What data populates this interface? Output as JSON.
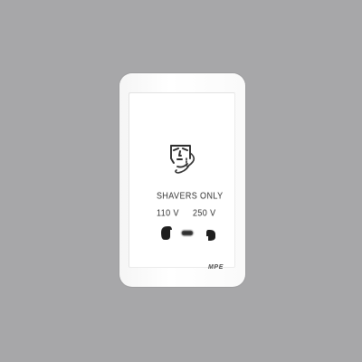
{
  "scene": {
    "background_color": "#a7a7a9",
    "plate_color": "#ffffff"
  },
  "plate": {
    "icon": "shaver-face-icon",
    "label_top": "SHAVERS   ONLY",
    "voltage_left": "110  V",
    "voltage_right": "250  V",
    "brand": "MPE"
  }
}
